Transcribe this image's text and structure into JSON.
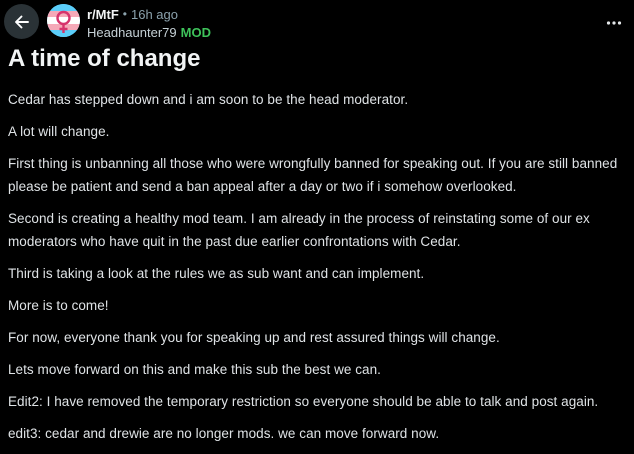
{
  "header": {
    "back_icon": "arrow-left-icon",
    "subreddit": "r/MtF",
    "separator": "•",
    "time_ago": "16h ago",
    "author": "Headhaunter79",
    "badge": "MOD",
    "more_icon": "ellipsis-horizontal-icon",
    "avatar_icon": "transgender-flag-avatar-icon"
  },
  "post": {
    "title": "A time of change",
    "paragraphs": [
      "Cedar has stepped down and i am soon to be the head moderator.",
      "A lot will change.",
      "First thing is unbanning all those who were wrongfully banned for speaking out. If you are still banned please be patient and send a ban appeal after a day or two if i somehow overlooked.",
      "Second is creating a healthy mod team. I am already in the process of reinstating some of our ex moderators who have quit in the past due earlier confrontations with Cedar.",
      "Third is taking a look at the rules we as sub want and can implement.",
      "More is to come!",
      "For now, everyone thank you for speaking up and rest assured things will change.",
      "Lets move forward on this and make this sub the best we can.",
      "Edit2: I have removed the temporary restriction so everyone should be able to talk and post again.",
      "edit3: cedar and drewie are no longer mods. we can move forward now."
    ]
  },
  "colors": {
    "background": "#000000",
    "back_button_bg": "#2a3236",
    "mod_badge": "#3ec25a",
    "flag_blue": "#5bcefa",
    "flag_pink": "#f5a9b8",
    "flag_white": "#ffffff"
  }
}
